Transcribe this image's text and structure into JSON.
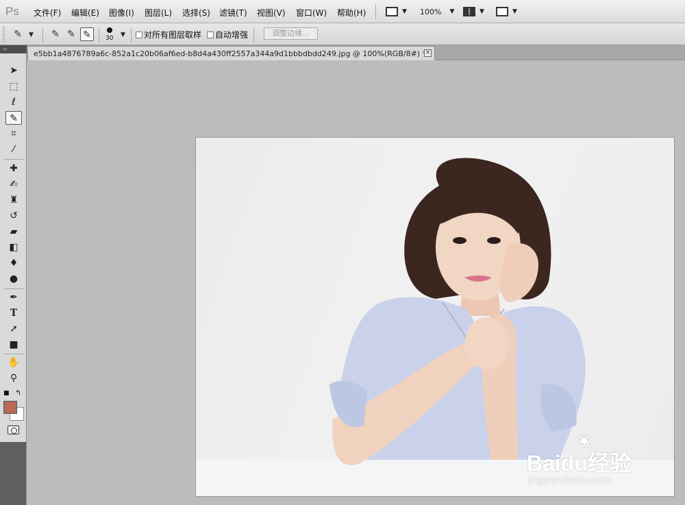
{
  "app": {
    "logo": "Ps"
  },
  "menu": [
    {
      "label": "文件(F)"
    },
    {
      "label": "编辑(E)"
    },
    {
      "label": "图像(I)"
    },
    {
      "label": "图层(L)"
    },
    {
      "label": "选择(S)"
    },
    {
      "label": "滤镜(T)"
    },
    {
      "label": "视图(V)"
    },
    {
      "label": "窗口(W)"
    },
    {
      "label": "帮助(H)"
    }
  ],
  "menubar_controls": {
    "zoom": "100%",
    "screen_mode_icon": "screen-mode-icon",
    "arrange_icon": "arrange-documents-icon",
    "launch_icon": "launch-bridge-icon"
  },
  "options": {
    "brush_size": "30",
    "sample_all_layers": "对所有图层取样",
    "auto_enhance": "自动增强",
    "refine_edge": "调整边缘..."
  },
  "document": {
    "tab_title": "e5bb1a4876789a6c-852a1c20b06af6ed-b8d4a430ff2557a344a9d1bbbdbdd249.jpg @ 100%(RGB/8#) *",
    "close_label": "×"
  },
  "toolbar": {
    "panel_toggle": "››",
    "tools": [
      {
        "name": "move-tool",
        "icon": "move-icon"
      },
      {
        "name": "rect-marquee-tool",
        "icon": "marquee-icon"
      },
      {
        "name": "lasso-tool",
        "icon": "lasso-icon"
      },
      {
        "name": "quick-selection-tool",
        "icon": "quick-selection-icon"
      },
      {
        "name": "crop-tool",
        "icon": "crop-icon"
      },
      {
        "name": "eyedropper-tool",
        "icon": "eyedropper-icon"
      },
      {
        "name": "healing-brush-tool",
        "icon": "bandage-icon"
      },
      {
        "name": "brush-tool",
        "icon": "brush-icon"
      },
      {
        "name": "clone-stamp-tool",
        "icon": "stamp-icon"
      },
      {
        "name": "history-brush-tool",
        "icon": "history-brush-icon"
      },
      {
        "name": "eraser-tool",
        "icon": "eraser-icon"
      },
      {
        "name": "gradient-tool",
        "icon": "gradient-icon"
      },
      {
        "name": "blur-tool",
        "icon": "blur-drop-icon"
      },
      {
        "name": "dodge-tool",
        "icon": "dodge-icon"
      },
      {
        "name": "pen-tool",
        "icon": "pen-icon"
      },
      {
        "name": "type-tool",
        "icon": "type-icon"
      },
      {
        "name": "path-selection-tool",
        "icon": "arrow-icon"
      },
      {
        "name": "shape-tool",
        "icon": "rectangle-icon"
      },
      {
        "name": "hand-tool",
        "icon": "hand-icon"
      },
      {
        "name": "zoom-tool",
        "icon": "zoom-icon"
      }
    ],
    "foreground_color": "#b76a56",
    "background_color": "#ffffff"
  },
  "watermark": {
    "brand": "Baidu",
    "brand_cn": "经验",
    "url": "jingyan.baidu.com"
  }
}
